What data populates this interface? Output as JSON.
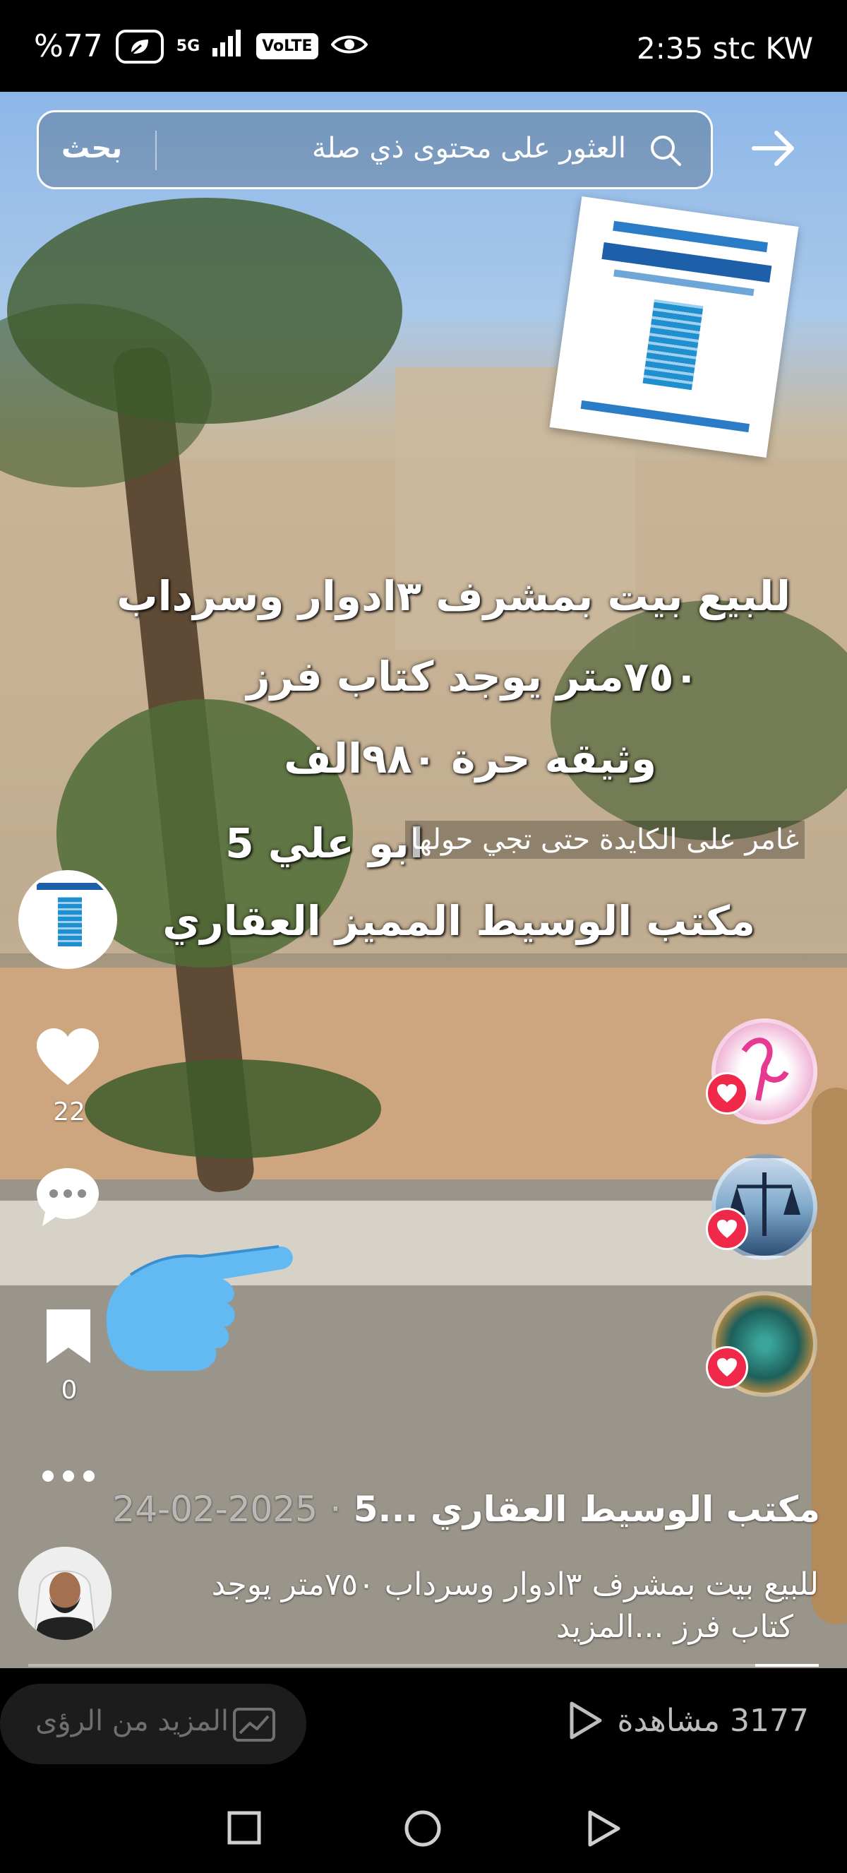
{
  "status_bar": {
    "battery": "%77",
    "network": "5G",
    "volte": "VoLTE",
    "time_carrier": "2:35 stc KW"
  },
  "search": {
    "button_label": "بحث",
    "placeholder": "العثور على محتوى ذي صلة"
  },
  "video_overlay": {
    "line1": "للبيع بيت بمشرف ٣ادوار وسرداب",
    "line2": "٧٥٠متر يوجد كتاب فرز",
    "line3": "وثيقه حرة ٩٨٠الف",
    "line4": "ابو علي 5",
    "line5": "مكتب الوسيط المميز العقاري",
    "floating_comment": "غامر على الكايدة حتى تجي حولها"
  },
  "actions": {
    "likes": "22",
    "saves": "0"
  },
  "post": {
    "author": "مكتب الوسيط العقاري ...5",
    "separator": "·",
    "date": "2025-02-24",
    "caption_line1": "للبيع بيت بمشرف ٣ادوار وسرداب ٧٥٠متر يوجد",
    "caption_line2": "كتاب فرز ...المزيد",
    "progress": 0.08
  },
  "bottom": {
    "insights_label": "المزيد من الرؤى",
    "views": "3177 مشاهدة"
  },
  "colors": {
    "like_red": "#f0284a",
    "accent_blue": "#1f8fd0"
  }
}
